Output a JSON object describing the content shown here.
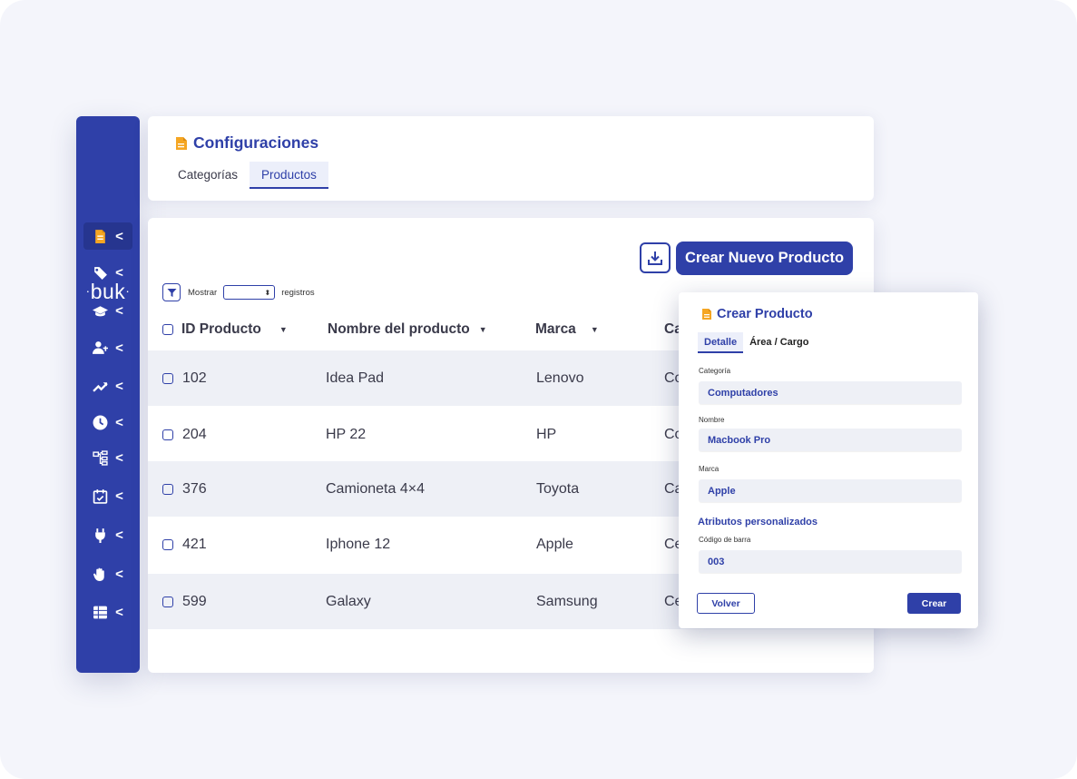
{
  "brand": {
    "logo_text": "buk",
    "logo_dot": "·"
  },
  "colors": {
    "primary": "#2f40a8",
    "accent": "#f5a623",
    "row_shade": "#eef0f6",
    "background": "#f4f5fb"
  },
  "sidebar": {
    "items": [
      {
        "icon": "document-icon",
        "chevron": "<",
        "active": true
      },
      {
        "icon": "tag-icon",
        "chevron": "<"
      },
      {
        "icon": "graduation-cap-icon",
        "chevron": "<"
      },
      {
        "icon": "user-transfer-icon",
        "chevron": "<"
      },
      {
        "icon": "trend-chart-icon",
        "chevron": "<"
      },
      {
        "icon": "clock-icon",
        "chevron": "<"
      },
      {
        "icon": "org-tree-icon",
        "chevron": "<"
      },
      {
        "icon": "calendar-icon",
        "chevron": "<"
      },
      {
        "icon": "plug-icon",
        "chevron": "<"
      },
      {
        "icon": "hand-icon",
        "chevron": "<"
      },
      {
        "icon": "grid-icon",
        "chevron": "<"
      }
    ]
  },
  "header": {
    "title": "Configuraciones",
    "tabs": [
      {
        "label": "Categorías",
        "active": false
      },
      {
        "label": "Productos",
        "active": true
      }
    ]
  },
  "toolbar": {
    "download_icon": "download-icon",
    "create_label": "Crear Nuevo Producto"
  },
  "show": {
    "prefix": "Mostrar",
    "suffix": "registros",
    "select_value": ""
  },
  "table": {
    "columns": [
      {
        "label": "ID Producto"
      },
      {
        "label": "Nombre del producto"
      },
      {
        "label": "Marca"
      },
      {
        "label": "Ca"
      }
    ],
    "rows": [
      {
        "id": "102",
        "name": "Idea Pad",
        "brand": "Lenovo",
        "cat": "Co"
      },
      {
        "id": "204",
        "name": "HP 22",
        "brand": "HP",
        "cat": "Co"
      },
      {
        "id": "376",
        "name": "Camioneta 4×4",
        "brand": "Toyota",
        "cat": "Ca"
      },
      {
        "id": "421",
        "name": "Iphone 12",
        "brand": "Apple",
        "cat": "Ce"
      },
      {
        "id": "599",
        "name": "Galaxy",
        "brand": "Samsung",
        "cat": "Ce"
      }
    ]
  },
  "modal": {
    "title": "Crear Producto",
    "tabs": [
      {
        "label": "Detalle",
        "active": true
      },
      {
        "label": "Área / Cargo",
        "active": false
      }
    ],
    "fields": [
      {
        "label": "Categoría",
        "value": "Computadores"
      },
      {
        "label": "Nombre",
        "value": "Macbook Pro"
      },
      {
        "label": "Marca",
        "value": "Apple"
      }
    ],
    "custom_section": "Atributos personalizados",
    "custom_fields": [
      {
        "label": "Código de barra",
        "value": "003"
      }
    ],
    "back_label": "Volver",
    "submit_label": "Crear"
  }
}
